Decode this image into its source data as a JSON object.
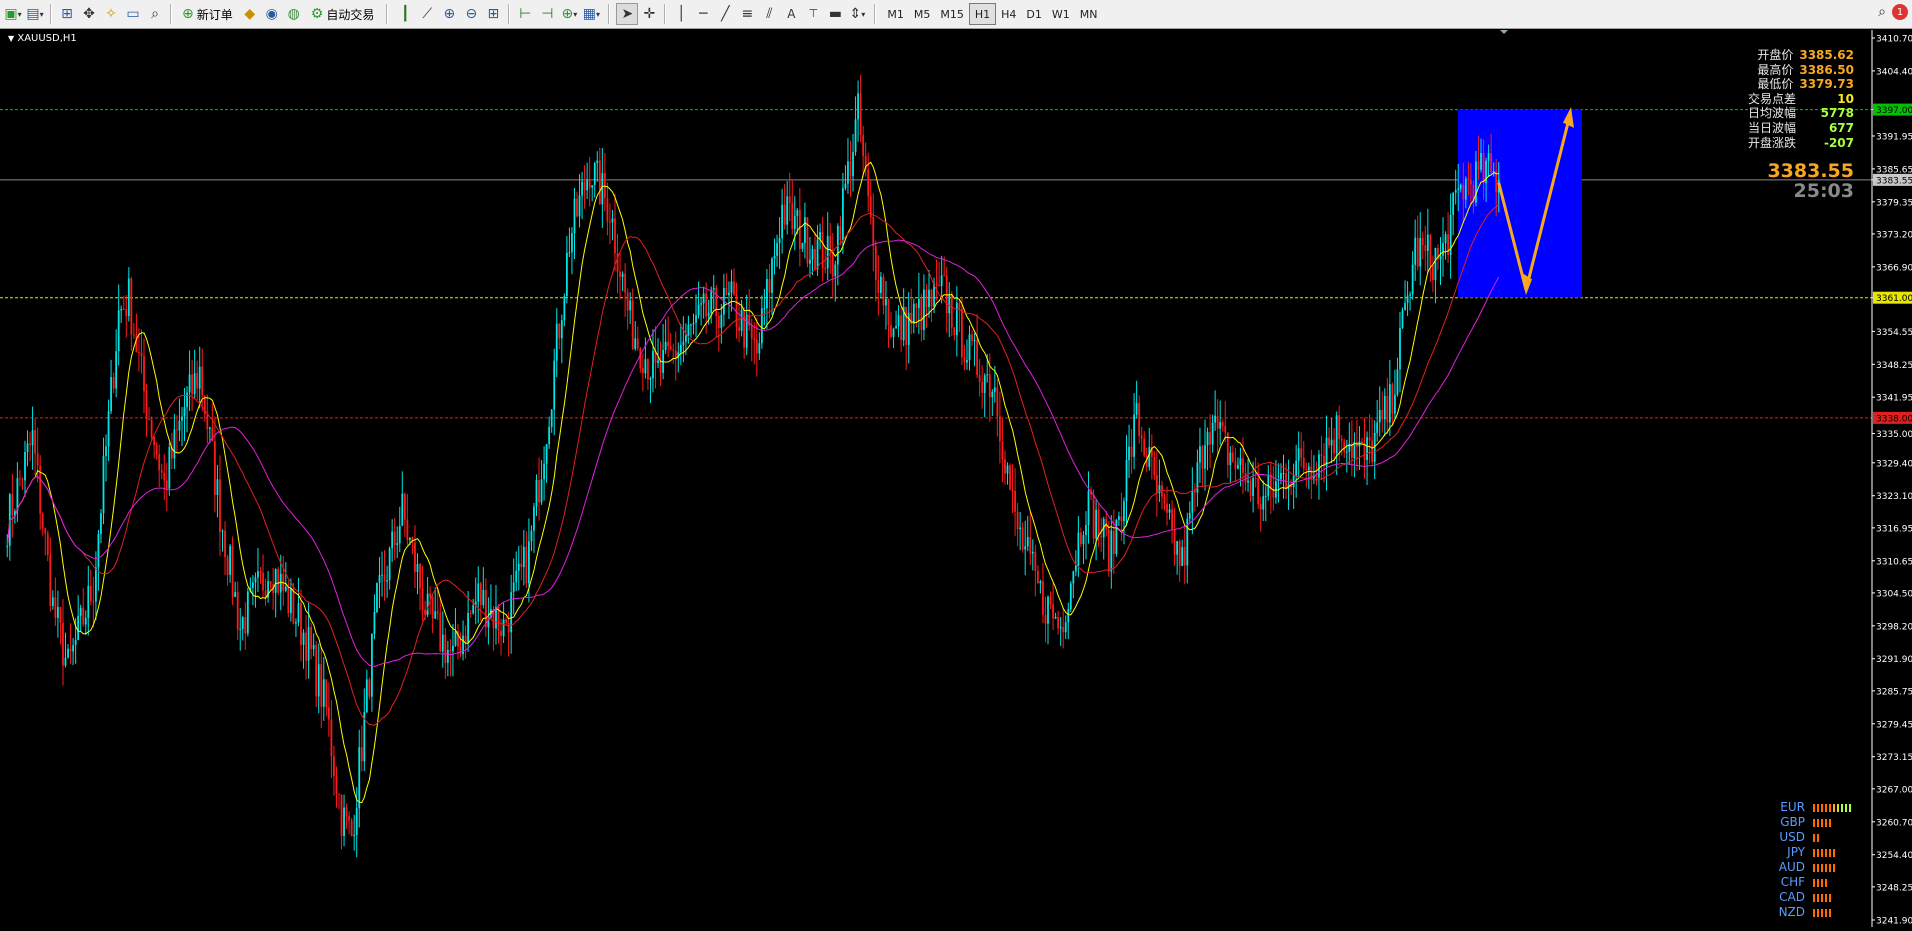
{
  "toolbar": {
    "new_order_label": "新订单",
    "auto_trade_label": "自动交易",
    "timeframes": [
      "M1",
      "M5",
      "M15",
      "H1",
      "H4",
      "D1",
      "W1",
      "MN"
    ],
    "active_timeframe": "H1",
    "notification_count": "1",
    "icons": [
      "new-chart-icon",
      "profiles-icon",
      "market-watch-icon",
      "navigator-icon",
      "data-window-icon",
      "terminal-icon",
      "strategy-tester-icon",
      "new-order-icon",
      "metaeditor-icon",
      "signals-icon",
      "market-icon",
      "auto-trading-icon",
      "bar-chart-icon",
      "line-chart-icon",
      "zoom-in-icon",
      "zoom-out-icon",
      "tile-windows-icon",
      "chart-shift-icon",
      "auto-scroll-icon",
      "indicators-icon",
      "templates-icon",
      "cursor-icon",
      "crosshair-icon",
      "vertical-line-icon",
      "horizontal-line-icon",
      "trendline-icon",
      "fibonacci-icon",
      "channel-icon",
      "text-icon",
      "text-label-icon",
      "rectangle-icon",
      "arrows-icon"
    ]
  },
  "chart": {
    "symbol": "XAUUSD,H1",
    "info": [
      {
        "label": "开盘价",
        "value": "3385.62",
        "color": "#f7a820"
      },
      {
        "label": "最高价",
        "value": "3386.50",
        "color": "#f7a820"
      },
      {
        "label": "最低价",
        "value": "3379.73",
        "color": "#f7a820"
      },
      {
        "label": "交易点差",
        "value": "10",
        "color": "#f7e820"
      },
      {
        "label": "日均波幅",
        "value": "5778",
        "color": "#a8ff40"
      },
      {
        "label": "当日波幅",
        "value": "677",
        "color": "#a8ff40"
      },
      {
        "label": "开盘涨跌",
        "value": "-207",
        "color": "#a8ff40"
      }
    ],
    "current_price": "3383.55",
    "timer": "25:03",
    "price_axis": [
      "3410.70",
      "3404.40",
      "3397.00",
      "3391.95",
      "3385.65",
      "3383.55",
      "3379.35",
      "3373.20",
      "3366.90",
      "3361.00",
      "3354.55",
      "3348.25",
      "3341.95",
      "3335.00",
      "3329.40",
      "3323.10",
      "3316.95",
      "3310.65",
      "3304.50",
      "3298.20",
      "3291.90",
      "3285.75",
      "3279.45",
      "3273.15",
      "3267.00",
      "3260.70",
      "3254.40",
      "3248.25",
      "3241.90"
    ],
    "levels": [
      {
        "price": "3397.00",
        "color": "#00c000",
        "label_color": "#000"
      },
      {
        "price": "3383.55",
        "color": "#8a8a8a",
        "label_color": "#000"
      },
      {
        "price": "3361.00",
        "color": "#e6e600",
        "label_color": "#000"
      },
      {
        "price": "3338.00",
        "color": "#e02020",
        "label_color": "#000"
      }
    ],
    "up_color": "#00e5e5",
    "down_color": "#ff1a1a",
    "ma_colors": [
      "#ffff00",
      "#e02020",
      "#e020e0"
    ],
    "zone_color": "#0000ff",
    "arrow_color": "#f7a820"
  },
  "currency_strength": [
    {
      "cur": "EUR",
      "bars": [
        "#ff6a00",
        "#ff6a00",
        "#ff6a00",
        "#ff6a00",
        "#ff6a00",
        "#f7a820",
        "#d8e020",
        "#a8ff40",
        "#a8ff40",
        "#a8ff40"
      ]
    },
    {
      "cur": "GBP",
      "bars": [
        "#ff6a00",
        "#ff6a00",
        "#ff6a00",
        "#ff6a00",
        "#ff6a00"
      ]
    },
    {
      "cur": "USD",
      "bars": [
        "#ff6a00",
        "#ff6a00"
      ]
    },
    {
      "cur": "JPY",
      "bars": [
        "#ff6a00",
        "#ff6a00",
        "#ff6a00",
        "#ff6a00",
        "#ff6a00",
        "#ff6a00"
      ]
    },
    {
      "cur": "AUD",
      "bars": [
        "#ff6a00",
        "#ff6a00",
        "#ff6a00",
        "#ff6a00",
        "#ff6a00",
        "#ff6a00"
      ]
    },
    {
      "cur": "CHF",
      "bars": [
        "#ff6a00",
        "#ff6a00",
        "#ff6a00",
        "#ff6a00"
      ]
    },
    {
      "cur": "CAD",
      "bars": [
        "#ff6a00",
        "#ff6a00",
        "#ff6a00",
        "#ff6a00",
        "#ff6a00"
      ]
    },
    {
      "cur": "NZD",
      "bars": [
        "#ff6a00",
        "#ff6a00",
        "#ff6a00",
        "#ff6a00",
        "#ff6a00"
      ]
    }
  ]
}
